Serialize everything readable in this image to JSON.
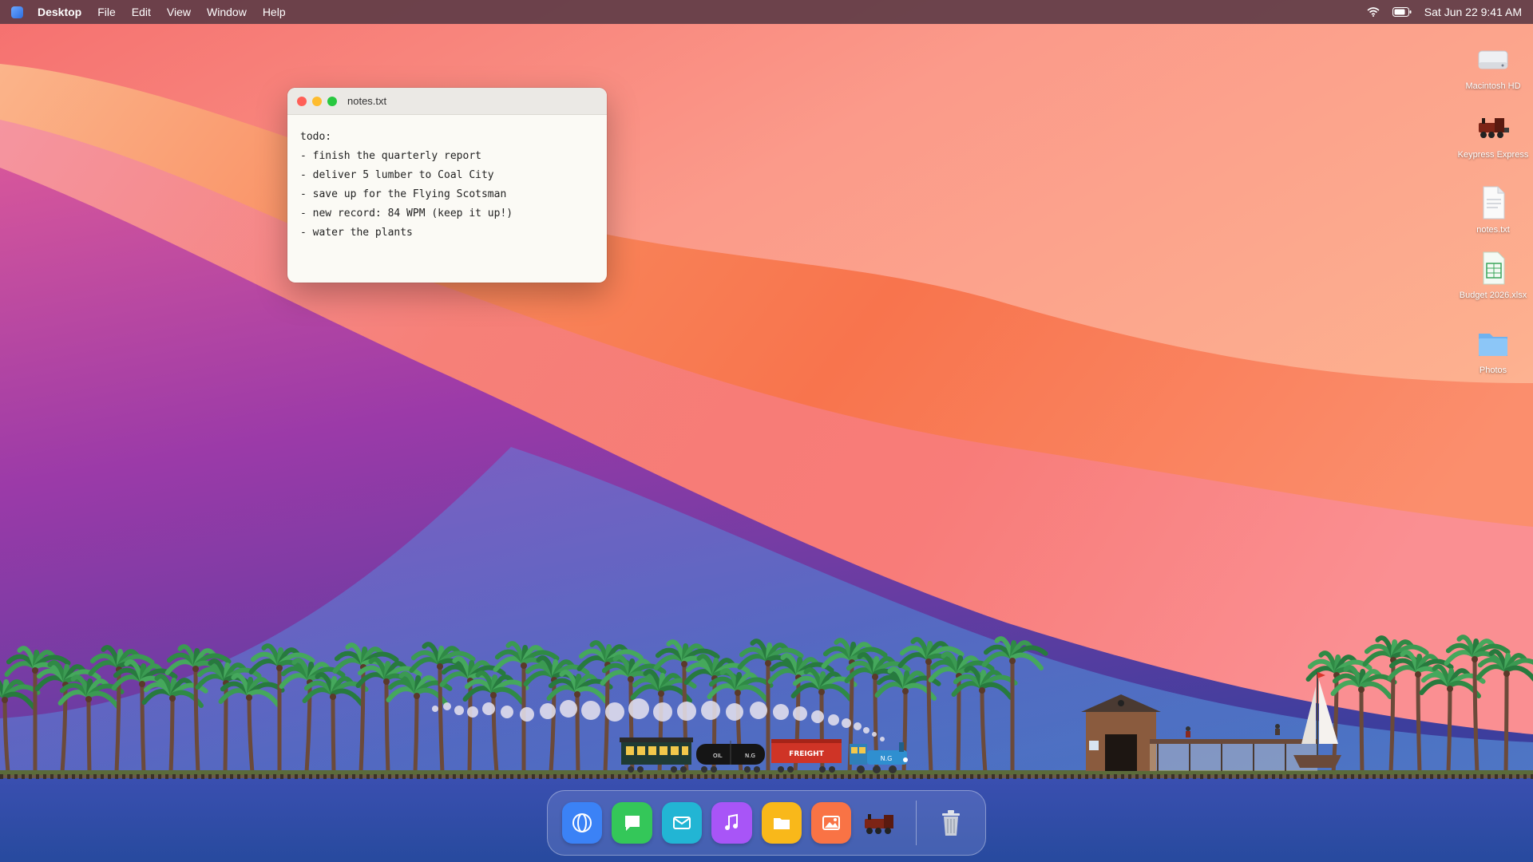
{
  "menubar": {
    "app_name": "Desktop",
    "menus": [
      "File",
      "Edit",
      "View",
      "Window",
      "Help"
    ],
    "clock": "Sat Jun 22  9:41 AM"
  },
  "notes_window": {
    "title": "notes.txt",
    "content": "todo:\n- finish the quarterly report\n- deliver 5 lumber to Coal City\n- save up for the Flying Scotsman\n- new record: 84 WPM (keep it up!)\n- water the plants"
  },
  "desktop_icons": [
    {
      "label": "Macintosh HD",
      "icon": "hard-drive-icon"
    },
    {
      "label": "Keypress Express",
      "icon": "locomotive-icon"
    },
    {
      "label": "notes.txt",
      "icon": "text-document-icon"
    },
    {
      "label": "Budget 2026.xlsx",
      "icon": "spreadsheet-icon"
    },
    {
      "label": "Photos",
      "icon": "folder-icon"
    }
  ],
  "train": {
    "oil_car_labels": [
      "OIL",
      "N.G"
    ],
    "freight_car_label": "FREIGHT",
    "engine_label": "N.G"
  },
  "dock": {
    "apps": [
      {
        "icon": "browser-icon",
        "color": "#3b82f6"
      },
      {
        "icon": "messages-icon",
        "color": "#34c759"
      },
      {
        "icon": "mail-icon",
        "color": "#22b5d4"
      },
      {
        "icon": "music-icon",
        "color": "#a855f7"
      },
      {
        "icon": "folder-icon",
        "color": "#f9b81a"
      },
      {
        "icon": "photos-icon",
        "color": "#f97345"
      },
      {
        "icon": "locomotive-icon",
        "color": "#8b2a1a"
      },
      {
        "icon": "trash-icon",
        "color": "#9aa4b8"
      }
    ]
  }
}
